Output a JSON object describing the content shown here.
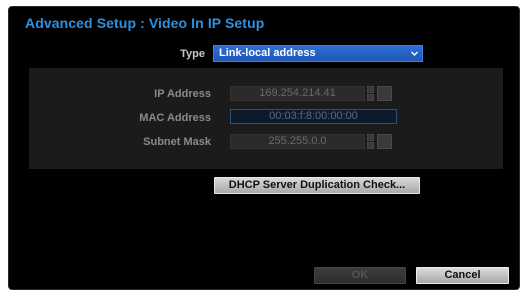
{
  "dialog": {
    "title": "Advanced Setup : Video In IP Setup"
  },
  "type_row": {
    "label": "Type",
    "selected": "Link-local address",
    "chevron_icon": "chevron-down-icon"
  },
  "fields": {
    "ip_label": "IP Address",
    "ip_value": "169.254.214.41",
    "mac_label": "MAC Address",
    "mac_value": "00:03:f:8:00:00:00",
    "subnet_label": "Subnet Mask",
    "subnet_value": "255.255.0.0",
    "spinner_icon": "spinner-arrows-icon",
    "keyboard_icon": "keyboard-icon"
  },
  "buttons": {
    "dhcp": "DHCP Server Duplication Check...",
    "ok": "OK",
    "cancel": "Cancel"
  },
  "colors": {
    "title": "#2f8fe0",
    "select_bg": "#1f56b5",
    "dialog_bg": "#000000"
  }
}
